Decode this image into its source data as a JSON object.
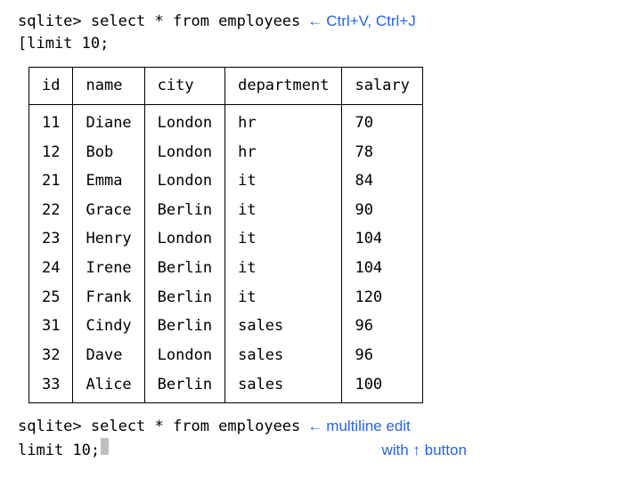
{
  "prompt1_line1_text": "sqlite> select * from employees",
  "prompt1_line2_text": "[limit 10;",
  "anno1_arrow": "←",
  "anno1_text": "Ctrl+V, Ctrl+J",
  "headers": [
    "id",
    "name",
    "city",
    "department",
    "salary"
  ],
  "rows": [
    [
      "11",
      "Diane",
      "London",
      "hr",
      "70"
    ],
    [
      "12",
      "Bob",
      "London",
      "hr",
      "78"
    ],
    [
      "21",
      "Emma",
      "London",
      "it",
      "84"
    ],
    [
      "22",
      "Grace",
      "Berlin",
      "it",
      "90"
    ],
    [
      "23",
      "Henry",
      "London",
      "it",
      "104"
    ],
    [
      "24",
      "Irene",
      "Berlin",
      "it",
      "104"
    ],
    [
      "25",
      "Frank",
      "Berlin",
      "it",
      "120"
    ],
    [
      "31",
      "Cindy",
      "Berlin",
      "sales",
      "96"
    ],
    [
      "32",
      "Dave",
      "London",
      "sales",
      "96"
    ],
    [
      "33",
      "Alice",
      "Berlin",
      "sales",
      "100"
    ]
  ],
  "prompt2_line1_text": "sqlite> select * from employees",
  "prompt2_line2_text": "limit 10;",
  "anno2_arrow": "←",
  "anno2_line1": "multiline edit",
  "anno2_line2": "with ↑ button"
}
